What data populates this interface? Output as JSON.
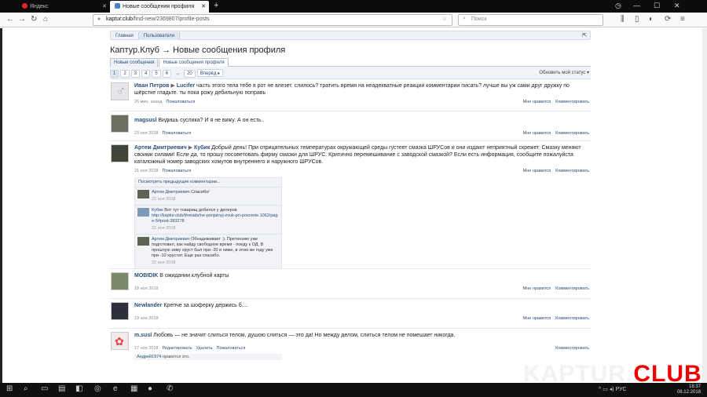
{
  "browser": {
    "tabs": [
      {
        "label": "Яндекс",
        "active": false
      },
      {
        "label": "Новые сообщения профиля",
        "active": true
      }
    ],
    "url_host": "kaptur.club",
    "url_path": "/find-new/2369807/profile-posts",
    "search_placeholder": "Поиск"
  },
  "forum": {
    "breadcrumbs": [
      "Главная",
      "Пользователи"
    ],
    "title": "Каптур.Клуб → Новые сообщения профиля",
    "tabs": [
      "Новые сообщения",
      "Новые сообщения профиля"
    ],
    "pages": [
      "1",
      "2",
      "3",
      "4",
      "5",
      "6",
      "→",
      "20"
    ],
    "next_label": "Вперёд ▸",
    "update_label": "Обновить мой статус"
  },
  "actions": {
    "like": "Мне нравится",
    "comment": "Комментировать",
    "complain": "Пожаловаться",
    "edit": "Редактировать",
    "delete": "Удалить"
  },
  "posts": [
    {
      "author": "Иван Петров",
      "target": "Lucifer",
      "text": "часть этого тела тебе в рот не влезет. слилось? тратить время на неадекватные реакции комментарии писать? лучше вы уж сами друг дружку по шёрстке гладьте. ты пока рожу дебильную поправь",
      "date": "26 мин. назад"
    },
    {
      "author": "magsusl",
      "text": "Видишь суслика? И я не вижу. А он есть..",
      "date": "23 ноя 2018"
    },
    {
      "author": "Артем Дмитриевич",
      "target": "Кубик",
      "text": "Добрый день! При отрицательных температурах окружающей среды густеет смазка ШРУСов и они издают неприятный скрежет. Смазку меняют своими силами! Если да, то прошу посоветовать фирму смазки для ШРУС. Критично перемешивание с заводской смазкой? Если есть информация, сообщите пожалуйста каталожный номер заводских хомутов внутреннего и наружного ШРУСов.",
      "date": "21 ноя 2018",
      "more_comments": "Посмотреть предыдущие комментарии...",
      "comments": [
        {
          "author": "Артем Дмитриевич",
          "text": "Спасибо!",
          "date": "22 ноя 2018"
        },
        {
          "author": "Кубик",
          "text": "Вот тут товарищ добился у дилеров",
          "link": "http://kaptur.club/threads/ne-ponjatnyj-zvuk-pri-povorote.1062/page-5#post-283278",
          "date": "22 ноя 2018"
        },
        {
          "author": "Артем Дмитриевич",
          "text": "Обнадеживает :). Претензию уже подготовил, как найду свободное время - поеду к ОД. В прошлую зиму хруст был при -20 и ниже, в этом же году уже при -10 хрустит. Еще раз спасибо.",
          "date": "22 ноя 2018"
        }
      ]
    },
    {
      "author": "MOBIDIK",
      "text": "В ожидании клубной карты",
      "date": "19 ноя 2018"
    },
    {
      "author": "Newlander",
      "text": "Крепче за шоферку держись б....",
      "date": "19 ноя 2018"
    },
    {
      "author": "m.susl",
      "text": "Любовь — не значит слиться телом, душою слиться — это да! Но между делом, слиться телом не помешает никогда.",
      "date": "17 ноя 2018",
      "like_user": "Андрей1974",
      "like_suffix": "нравится это."
    }
  ],
  "watermark": {
    "a": "KAPTUR.",
    "b": "CLUB"
  },
  "taskbar": {
    "lang": "РУС",
    "time": "18:37",
    "date": "08.12.2018"
  }
}
